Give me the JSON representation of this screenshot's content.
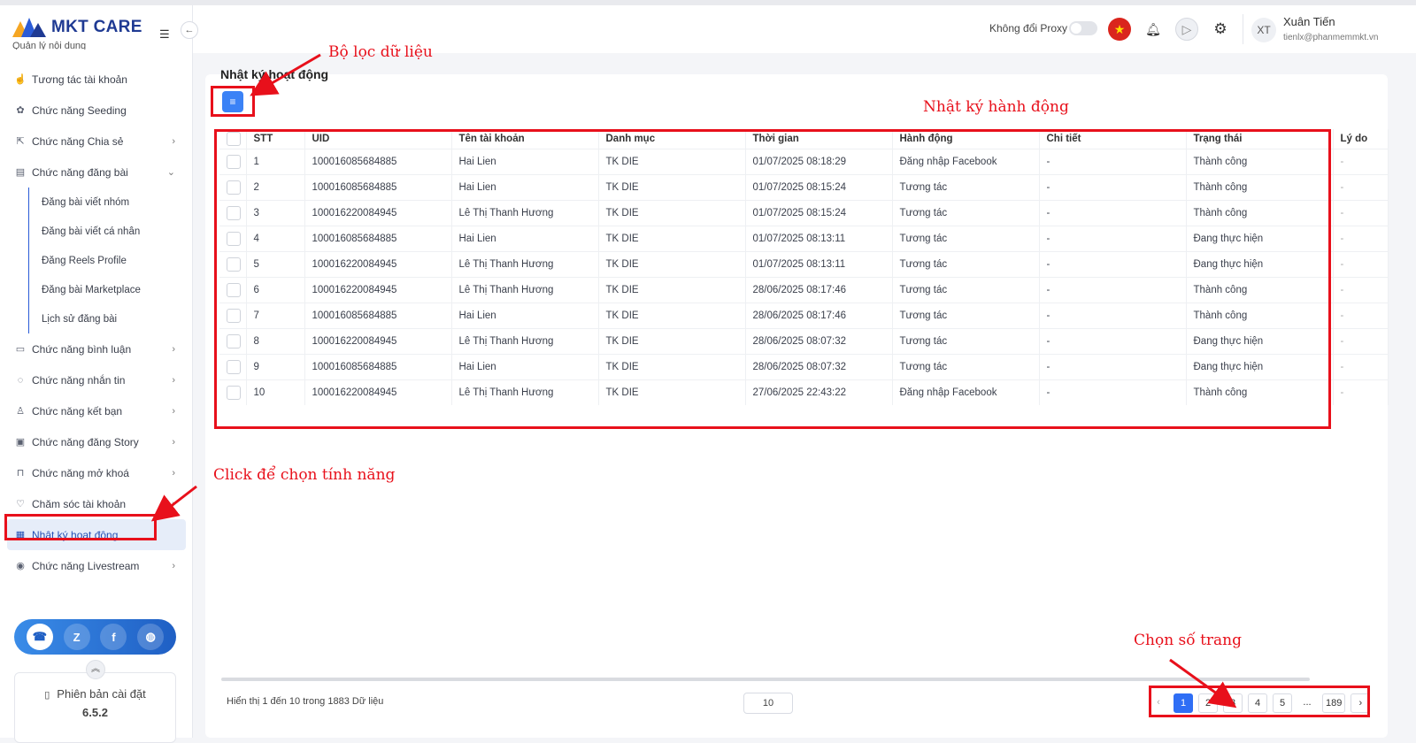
{
  "brand": {
    "name": "MKT CARE"
  },
  "sidebar": {
    "cut_item": "Quản lý nội dung",
    "items": [
      {
        "label": "Tương tác tài khoản",
        "icon": "tap-icon",
        "glyph": "☝",
        "chevron": false
      },
      {
        "label": "Chức năng Seeding",
        "icon": "seed-icon",
        "glyph": "✿",
        "chevron": false
      },
      {
        "label": "Chức năng Chia sẻ",
        "icon": "share-icon",
        "glyph": "⇱",
        "chevron": true
      },
      {
        "label": "Chức năng đăng bài",
        "icon": "post-icon",
        "glyph": "▤",
        "chevron": true
      }
    ],
    "sub_items": [
      "Đăng bài viết nhóm",
      "Đăng bài viết cá nhân",
      "Đăng Reels Profile",
      "Đăng bài Marketplace",
      "Lịch sử đăng bài"
    ],
    "items2": [
      {
        "label": "Chức năng bình luận",
        "icon": "comment-icon",
        "glyph": "▭"
      },
      {
        "label": "Chức năng nhắn tin",
        "icon": "message-icon",
        "glyph": "◌"
      },
      {
        "label": "Chức năng kết bạn",
        "icon": "add-friend-icon",
        "glyph": "♙"
      },
      {
        "label": "Chức năng đăng Story",
        "icon": "story-icon",
        "glyph": "▣"
      },
      {
        "label": "Chức năng mở khoá",
        "icon": "lock-icon",
        "glyph": "⊓"
      },
      {
        "label": "Chăm sóc tài khoản",
        "icon": "care-icon",
        "glyph": "♡"
      }
    ],
    "active_item": {
      "label": "Nhật ký hoạt động",
      "icon": "log-icon",
      "glyph": "▦"
    },
    "last_item": {
      "label": "Chức năng Livestream",
      "icon": "livestream-icon",
      "glyph": "◉"
    },
    "social": [
      {
        "name": "support-icon",
        "glyph": "☎"
      },
      {
        "name": "zalo-icon",
        "glyph": "Z"
      },
      {
        "name": "facebook-icon",
        "glyph": "f"
      },
      {
        "name": "globe-icon",
        "glyph": "◍"
      }
    ],
    "version_label": "Phiên bản cài đặt",
    "version_number": "6.5.2"
  },
  "header": {
    "proxy_label": "Không đổi Proxy",
    "avatar_initials": "XT",
    "user_name": "Xuân Tiến",
    "user_email": "tienlx@phanmemmkt.vn"
  },
  "page": {
    "title": "Nhật ký hoạt động"
  },
  "annotations": {
    "filter": "Bộ lọc dữ liệu",
    "log": "Nhật ký hành động",
    "click": "Click để chọn tính năng",
    "pages": "Chọn số trang"
  },
  "table": {
    "columns": [
      "STT",
      "UID",
      "Tên tài khoản",
      "Danh mục",
      "Thời gian",
      "Hành động",
      "Chi tiết",
      "Trạng thái",
      "Lý do"
    ],
    "rows": [
      [
        "1",
        "100016085684885",
        "Hai Lien",
        "TK DIE",
        "01/07/2025 08:18:29",
        "Đăng nhập Facebook",
        "-",
        "Thành công",
        "-"
      ],
      [
        "2",
        "100016085684885",
        "Hai Lien",
        "TK DIE",
        "01/07/2025 08:15:24",
        "Tương tác",
        "-",
        "Thành công",
        "-"
      ],
      [
        "3",
        "100016220084945",
        "Lê Thị Thanh Hương",
        "TK DIE",
        "01/07/2025 08:15:24",
        "Tương tác",
        "-",
        "Thành công",
        "-"
      ],
      [
        "4",
        "100016085684885",
        "Hai Lien",
        "TK DIE",
        "01/07/2025 08:13:11",
        "Tương tác",
        "-",
        "Đang thực hiện",
        "-"
      ],
      [
        "5",
        "100016220084945",
        "Lê Thị Thanh Hương",
        "TK DIE",
        "01/07/2025 08:13:11",
        "Tương tác",
        "-",
        "Đang thực hiện",
        "-"
      ],
      [
        "6",
        "100016220084945",
        "Lê Thị Thanh Hương",
        "TK DIE",
        "28/06/2025 08:17:46",
        "Tương tác",
        "-",
        "Thành công",
        "-"
      ],
      [
        "7",
        "100016085684885",
        "Hai Lien",
        "TK DIE",
        "28/06/2025 08:17:46",
        "Tương tác",
        "-",
        "Thành công",
        "-"
      ],
      [
        "8",
        "100016220084945",
        "Lê Thị Thanh Hương",
        "TK DIE",
        "28/06/2025 08:07:32",
        "Tương tác",
        "-",
        "Đang thực hiện",
        "-"
      ],
      [
        "9",
        "100016085684885",
        "Hai Lien",
        "TK DIE",
        "28/06/2025 08:07:32",
        "Tương tác",
        "-",
        "Đang thực hiện",
        "-"
      ],
      [
        "10",
        "100016220084945",
        "Lê Thị Thanh Hương",
        "TK DIE",
        "27/06/2025 22:43:22",
        "Đăng nhập Facebook",
        "-",
        "Thành công",
        "-"
      ]
    ]
  },
  "footer": {
    "info": "Hiển thị 1 đến 10 trong 1883 Dữ liệu",
    "page_size": "10",
    "pages": [
      "1",
      "2",
      "3",
      "4",
      "5",
      "...",
      "189"
    ],
    "current_page": "1"
  },
  "colors": {
    "accent": "#2f6ef5",
    "annotation": "#e8101b"
  }
}
